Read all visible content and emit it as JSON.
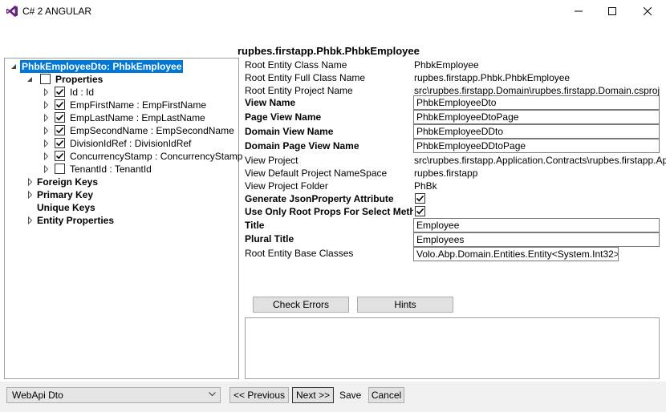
{
  "window": {
    "title": "C# 2 ANGULAR",
    "accent": "#0078d7"
  },
  "entity_title": "rupbes.firstapp.Phbk.PhbkEmployee",
  "tree": {
    "root": "PhbkEmployeeDto: PhbkEmployee",
    "properties_label": "Properties",
    "properties": [
      {
        "label": "Id : Id",
        "checked": true
      },
      {
        "label": "EmpFirstName : EmpFirstName",
        "checked": true
      },
      {
        "label": "EmpLastName : EmpLastName",
        "checked": true
      },
      {
        "label": "EmpSecondName : EmpSecondName",
        "checked": true
      },
      {
        "label": "DivisionIdRef : DivisionIdRef",
        "checked": true
      },
      {
        "label": "ConcurrencyStamp : ConcurrencyStamp",
        "checked": true
      },
      {
        "label": "TenantId : TenantId",
        "checked": false
      }
    ],
    "foreign_keys": "Foreign Keys",
    "primary_key": "Primary Key",
    "unique_keys": "Unique Keys",
    "entity_properties": "Entity Properties"
  },
  "props": {
    "root_entity_class_name": {
      "label": "Root Entity Class Name",
      "value": "PhbkEmployee"
    },
    "root_entity_full_class_name": {
      "label": "Root Entity Full Class Name",
      "value": "rupbes.firstapp.Phbk.PhbkEmployee"
    },
    "root_entity_project_name": {
      "label": "Root Entity Project Name",
      "value": "src\\rupbes.firstapp.Domain\\rupbes.firstapp.Domain.csproj"
    },
    "view_name": {
      "label": "View Name",
      "value": "PhbkEmployeeDto"
    },
    "page_view_name": {
      "label": "Page View Name",
      "value": "PhbkEmployeeDtoPage"
    },
    "domain_view_name": {
      "label": "Domain View Name",
      "value": "PhbkEmployeeDDto"
    },
    "domain_page_view_name": {
      "label": "Domain Page View Name",
      "value": "PhbkEmployeeDDtoPage"
    },
    "view_project": {
      "label": "View Project",
      "value": "src\\rupbes.firstapp.Application.Contracts\\rupbes.firstapp.Ap"
    },
    "view_default_project_namespace": {
      "label": "View Default Project NameSpace",
      "value": "rupbes.firstapp"
    },
    "view_project_folder": {
      "label": "View Project Folder",
      "value": "PhBk"
    },
    "generate_json_property": {
      "label": "Generate JsonProperty Attribute",
      "checked": true
    },
    "use_only_root_props": {
      "label": "Use Only Root Props For Select Metho",
      "checked": true
    },
    "title": {
      "label": "Title",
      "value": "Employee"
    },
    "plural_title": {
      "label": "Plural Title",
      "value": "Employees"
    },
    "root_entity_base_classes": {
      "label": "Root Entity Base Classes",
      "value": "Volo.Abp.Domain.Entities.Entity<System.Int32>"
    }
  },
  "buttons": {
    "check_errors": "Check Errors",
    "hints": "Hints",
    "previous": "<< Previous",
    "next": "Next >>",
    "save": "Save",
    "cancel": "Cancel"
  },
  "footer": {
    "mode_selected": "WebApi Dto"
  },
  "icons": {
    "app": "visual-studio-icon",
    "minimize": "minimize-icon",
    "maximize": "maximize-icon",
    "close": "close-icon"
  }
}
